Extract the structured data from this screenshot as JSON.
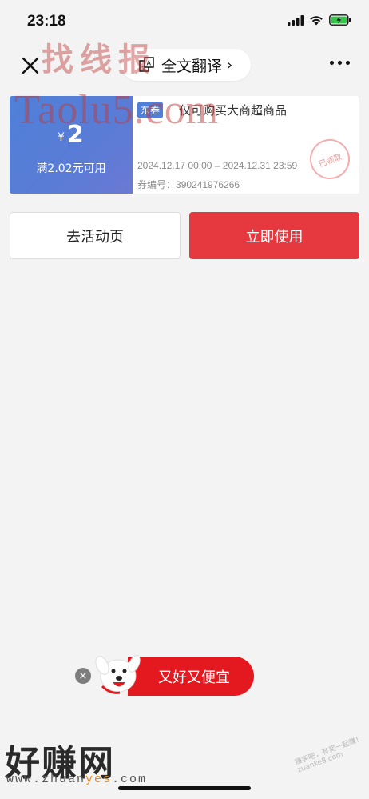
{
  "status_bar": {
    "time": "23:18"
  },
  "nav": {
    "translate_label": "全文翻译",
    "translate_chevron": "›"
  },
  "watermarks": {
    "top": "找线报",
    "mid": "Taolu5.com",
    "bottom_big": "好赚网",
    "bottom_url_pre": "www.zhuan",
    "bottom_url_hl": "yes",
    "bottom_url_post": ".com",
    "bottom_small": "赚客吧，有奖一起赚！ zuanke8.com"
  },
  "coupon": {
    "currency": "¥",
    "amount": "2",
    "condition": "满2.02元可用",
    "tag": "东券",
    "title": "仅可购买大商超商品",
    "validity": "2024.12.17 00:00 – 2024.12.31 23:59",
    "code_label": "券编号：",
    "code": "390241976266",
    "stamp": "已领取"
  },
  "buttons": {
    "activity": "去活动页",
    "use": "立即使用"
  },
  "promo": {
    "close": "×",
    "text": "又好又便宜"
  },
  "colors": {
    "accent_red": "#e5383f",
    "coupon_blue": "#5a7cd6",
    "promo_red": "#e4181f",
    "background": "#f3f3f3"
  }
}
